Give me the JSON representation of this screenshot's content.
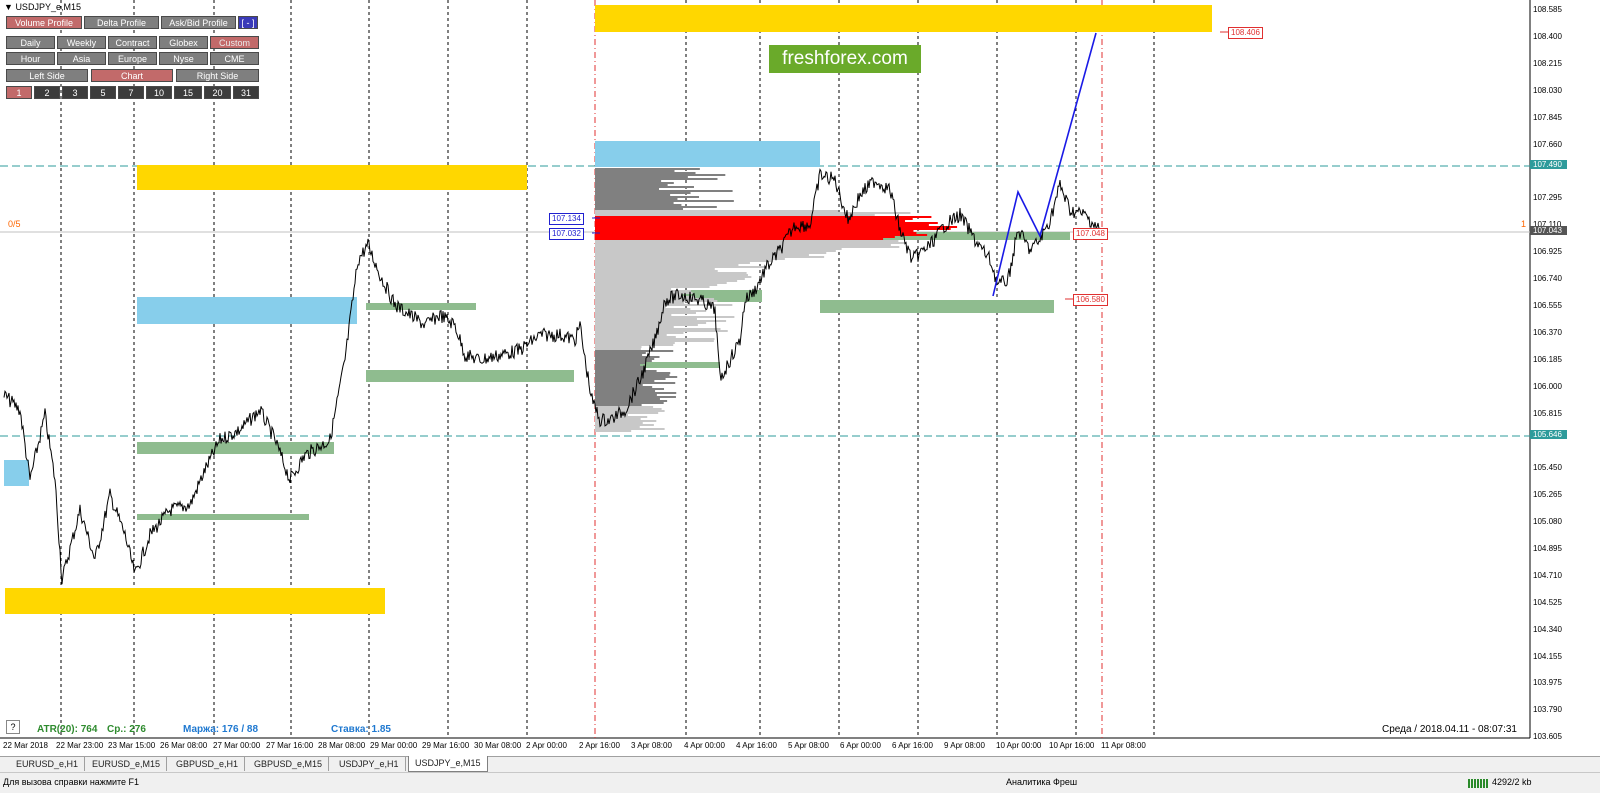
{
  "window": {
    "title": "USDJPY_e,M15"
  },
  "panel": {
    "row1": [
      "Volume Profile",
      "Delta Profile",
      "Ask/Bid Profile",
      "[ - ]"
    ],
    "row2": [
      "Daily",
      "Weekly",
      "Contract",
      "Globex",
      "Custom"
    ],
    "row3": [
      "Hour",
      "Asia",
      "Europe",
      "Nyse",
      "CME"
    ],
    "row4": [
      "Left Side",
      "Chart",
      "Right Side"
    ],
    "row5": [
      "1",
      "2",
      "3",
      "5",
      "7",
      "10",
      "15",
      "20",
      "31"
    ]
  },
  "watermark": "freshforex.com",
  "left_label": "0/5",
  "right_marker": "1",
  "price_axis": [
    "108.585",
    "108.400",
    "108.215",
    "108.030",
    "107.845",
    "107.660",
    "107.490",
    "107.295",
    "107.110",
    "107.043",
    "106.925",
    "106.740",
    "106.555",
    "106.370",
    "106.185",
    "106.000",
    "105.815",
    "105.646",
    "105.450",
    "105.265",
    "105.080",
    "104.895",
    "104.710",
    "104.525",
    "104.340",
    "104.155",
    "103.975",
    "103.790",
    "103.605"
  ],
  "price_tags": {
    "p107134": "107.134",
    "p107032": "107.032",
    "p108406": "108.406",
    "p106580": "106.580",
    "p107048": "107.048"
  },
  "time_axis": [
    "22 Mar 2018",
    "22 Mar 23:00",
    "23 Mar 15:00",
    "26 Mar 08:00",
    "27 Mar 00:00",
    "27 Mar 16:00",
    "28 Mar 08:00",
    "29 Mar 00:00",
    "29 Mar 16:00",
    "30 Mar 08:00",
    "2 Apr 00:00",
    "2 Apr 16:00",
    "3 Apr 08:00",
    "4 Apr 00:00",
    "4 Apr 16:00",
    "5 Apr 08:00",
    "6 Apr 00:00",
    "6 Apr 16:00",
    "9 Apr 08:00",
    "10 Apr 00:00",
    "10 Apr 16:00",
    "11 Apr 08:00"
  ],
  "stats": {
    "atr": "ATR(20): 764",
    "avg": "Ср.: 276",
    "margin": "Маржа: 176 / 88",
    "rate": "Ставка: 1.85"
  },
  "help_icon": "?",
  "datetime": "Среда  /  2018.04.11  -  08:07:31",
  "tabs": [
    "EURUSD_e,H1",
    "EURUSD_e,M15",
    "GBPUSD_e,H1",
    "GBPUSD_e,M15",
    "USDJPY_e,H1",
    "USDJPY_e,M15"
  ],
  "status": {
    "help": "Для вызова справки нажмите F1",
    "profile": "Аналитика Фреш",
    "traffic": "4292/2 kb"
  },
  "colors": {
    "yellow": "#ffd700",
    "blue_zone": "#87ceeb",
    "green_zone": "#8fbc8f",
    "teal_line": "#2e9b9b",
    "red_tag": "#e03030",
    "blue_tag": "#2020d0",
    "watermark_bg": "#6aaa2a"
  }
}
